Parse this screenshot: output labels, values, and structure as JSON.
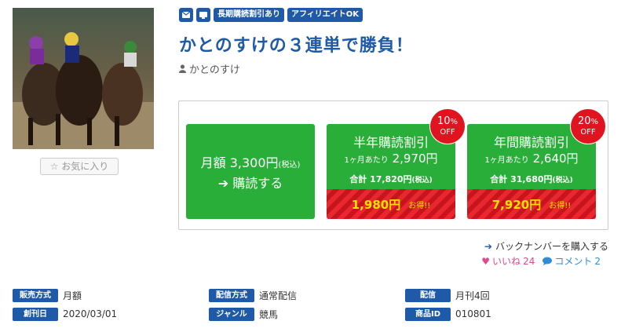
{
  "header": {
    "tags": [
      "長期購読割引あり",
      "アフィリエイトOK"
    ],
    "title": "かとのすけの３連単で勝負！",
    "author": "かとのすけ"
  },
  "favorite_label": "お気に入り",
  "plans": {
    "monthly": {
      "price_label": "月額 3,300円",
      "tax": "(税込)",
      "subscribe_label": "購読する"
    },
    "half": {
      "title": "半年購読割引",
      "per_month_label": "1ヶ月あたり",
      "per_month_price": "2,970円",
      "total_label": "合計 17,820円",
      "tax": "(税込)",
      "save_amount": "1,980円",
      "otoku": "お得!!",
      "badge_pct": "10",
      "badge_pct_sign": "%",
      "badge_off": "OFF"
    },
    "year": {
      "title": "年間購読割引",
      "per_month_label": "1ヶ月あたり",
      "per_month_price": "2,640円",
      "total_label": "合計 31,680円",
      "tax": "(税込)",
      "save_amount": "7,920円",
      "otoku": "お得!!",
      "badge_pct": "20",
      "badge_pct_sign": "%",
      "badge_off": "OFF"
    }
  },
  "backnumber_label": "バックナンバーを購入する",
  "social": {
    "like_label": "いいね",
    "like_count": "24",
    "comment_label": "コメント",
    "comment_count": "2"
  },
  "info": [
    [
      {
        "label": "販売方式",
        "value": "月額"
      },
      {
        "label": "配信方式",
        "value": "通常配信"
      },
      {
        "label": "配信",
        "value": "月刊4回"
      }
    ],
    [
      {
        "label": "創刊日",
        "value": "2020/03/01"
      },
      {
        "label": "ジャンル",
        "value": "競馬"
      },
      {
        "label": "商品ID",
        "value": "010801"
      }
    ]
  ],
  "colors": {
    "brand_blue": "#1e5aa8",
    "plan_green": "#2aae3a",
    "save_red": "#e8272e",
    "like_pink": "#e0498d",
    "comment_blue": "#2e8ed3"
  }
}
